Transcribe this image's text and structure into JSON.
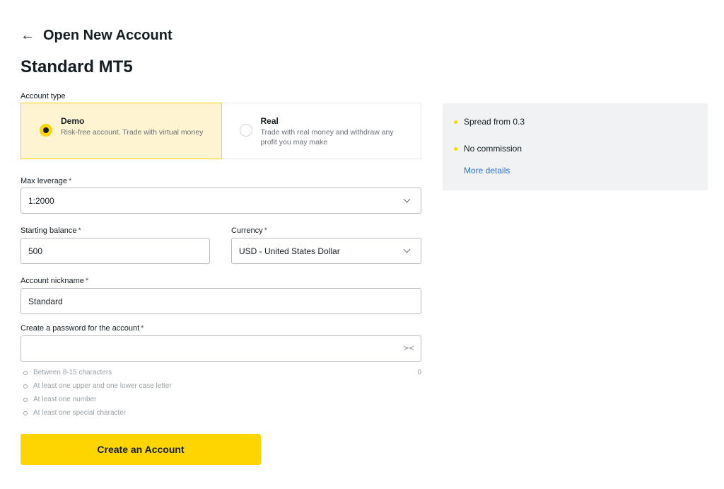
{
  "header": {
    "back_label": "←",
    "title": "Open New Account"
  },
  "page_title": "Standard MT5",
  "account_type": {
    "label": "Account type",
    "options": [
      {
        "title": "Demo",
        "description": "Risk-free account. Trade with virtual money",
        "selected": true
      },
      {
        "title": "Real",
        "description": "Trade with real money and withdraw any profit you may make",
        "selected": false
      }
    ]
  },
  "max_leverage": {
    "label": "Max leverage",
    "required": "*",
    "value": "1:2000"
  },
  "starting_balance": {
    "label": "Starting balance",
    "required": "*",
    "value": "500"
  },
  "currency": {
    "label": "Currency",
    "required": "*",
    "value": "USD - United States Dollar"
  },
  "nickname": {
    "label": "Account nickname",
    "required": "*",
    "value": "Standard"
  },
  "password": {
    "label": "Create a password for the account",
    "required": "*",
    "value": "",
    "counter": "0",
    "eye_icon": "eye-closed-icon",
    "rules": [
      "Between 8-15 characters",
      "At least one upper and one lower case letter",
      "At least one number",
      "At least one special character"
    ]
  },
  "submit_label": "Create an Account",
  "info": {
    "items": [
      "Spread from 0.3",
      "No commission"
    ],
    "link": "More details"
  },
  "colors": {
    "accent": "#ffd500",
    "selected_bg": "#fff4d1",
    "link": "#2e6ed8",
    "panel_bg": "#f0f2f4"
  }
}
